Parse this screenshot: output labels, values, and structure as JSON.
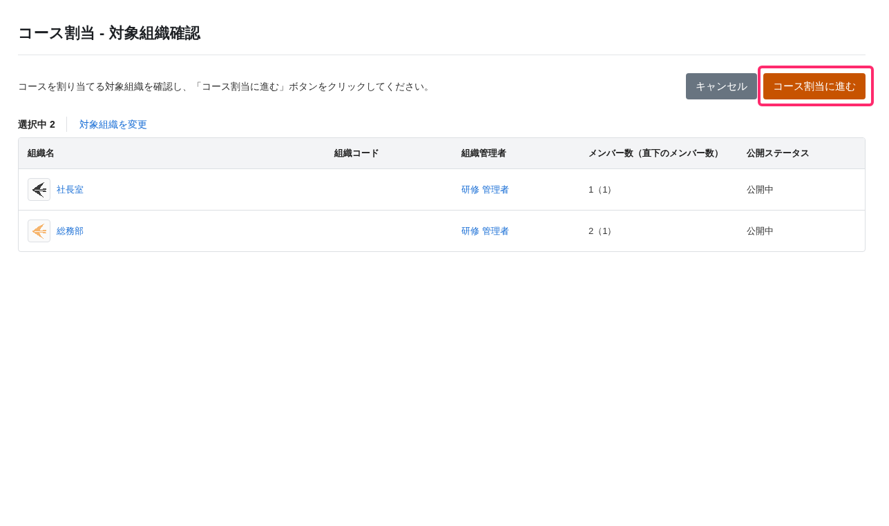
{
  "page": {
    "title": "コース割当 - 対象組織確認"
  },
  "instruction": "コースを割り当てる対象組織を確認し、「コース割当に進む」ボタンをクリックしてください。",
  "buttons": [
    {
      "label": "キャンセル",
      "kind": "secondary",
      "highlighted": false
    },
    {
      "label": "コース割当に進む",
      "kind": "primary",
      "highlighted": true
    }
  ],
  "selection": {
    "count_label": "選択中 2",
    "change_link": "対象組織を変更"
  },
  "table": {
    "columns": [
      "組織名",
      "組織コード",
      "組織管理者",
      "メンバー数（直下のメンバー数）",
      "公開ステータス"
    ],
    "rows": [
      {
        "name": "社長室",
        "color": "#3a3a3a",
        "manager": "研修 管理者",
        "members": "1（1）",
        "status": "公開中"
      },
      {
        "name": "総務部",
        "color": "#f6b56e",
        "manager": "研修 管理者",
        "members": "2（1）",
        "status": "公開中"
      }
    ]
  }
}
